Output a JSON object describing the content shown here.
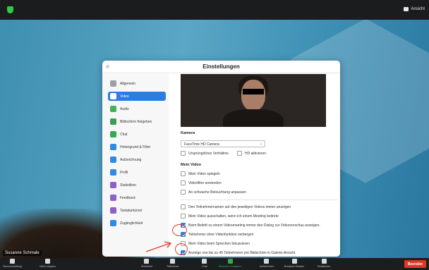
{
  "topbar": {
    "view_label": "Ansicht"
  },
  "dialog": {
    "title": "Einstellungen",
    "sidebar": [
      {
        "label": "Allgemein",
        "color": "#9aa0a6",
        "active": false
      },
      {
        "label": "Video",
        "color": "#2a7de1",
        "active": true
      },
      {
        "label": "Audio",
        "color": "#41b35a",
        "active": false
      },
      {
        "label": "Bildschirm freigeben",
        "color": "#3a9e5a",
        "active": false
      },
      {
        "label": "Chat",
        "color": "#34a853",
        "active": false
      },
      {
        "label": "Hintergrund & Filter",
        "color": "#2f8be0",
        "active": false
      },
      {
        "label": "Aufzeichnung",
        "color": "#2f8be0",
        "active": false
      },
      {
        "label": "Profil",
        "color": "#2f8be0",
        "active": false
      },
      {
        "label": "Statistiken",
        "color": "#8e61c7",
        "active": false
      },
      {
        "label": "Feedback",
        "color": "#8e61c7",
        "active": false
      },
      {
        "label": "Tastaturkürzel",
        "color": "#8e61c7",
        "active": false
      },
      {
        "label": "Zugänglichkeit",
        "color": "#2f8be0",
        "active": false
      }
    ],
    "camera_heading": "Kamera",
    "camera_value": "FaceTime HD Camera",
    "camera_opts": [
      {
        "label": "Ursprüngliches Verhältnis",
        "checked": false
      },
      {
        "label": "HD aktivieren",
        "checked": false
      }
    ],
    "myvideo_heading": "Mein Video",
    "myvideo_opts": [
      {
        "label": "Mein Video spiegeln",
        "checked": false
      },
      {
        "label": "Videofilter anwenden",
        "checked": false
      },
      {
        "label": "An schwache Beleuchtung anpassen",
        "checked": false
      }
    ],
    "more_opts": [
      {
        "label": "Den Teilnehmernamen auf den jeweiligen Videos immer anzeigen",
        "checked": false
      },
      {
        "label": "Mein Video ausschalten, wenn ich einem Meeting beitrete",
        "checked": false
      },
      {
        "label": "Beim Beitritt zu einem Videomeeting immer den Dialog zur Videovorschau anzeigen.",
        "checked": true
      },
      {
        "label": "Teilnehmer ohne Videofunktion verbergen",
        "checked": true
      },
      {
        "label": "Mein Video beim Sprechen fokussieren",
        "checked": false
      },
      {
        "label": "Anzeige von bis zu 49 Teilnehmern pro Bildschirm in Galerie-Ansicht",
        "checked": true
      }
    ]
  },
  "participant_name": "Susanne Schmale",
  "toolbar": {
    "items": [
      {
        "label": "Stummschaltung",
        "icon": "microphone-icon"
      },
      {
        "label": "Video stoppen",
        "icon": "video-camera-icon"
      },
      {
        "label": "Sicherheit",
        "icon": "shield-icon"
      },
      {
        "label": "Teilnehmer",
        "icon": "participants-icon"
      },
      {
        "label": "Chat",
        "icon": "chat-icon"
      },
      {
        "label": "Bildschirm freigeben",
        "icon": "share-screen-icon"
      },
      {
        "label": "Aufzeichnen",
        "icon": "record-icon"
      },
      {
        "label": "Breakout Session",
        "icon": "breakout-icon"
      },
      {
        "label": "Reaktionen",
        "icon": "reactions-icon"
      }
    ],
    "end_label": "Beenden"
  }
}
